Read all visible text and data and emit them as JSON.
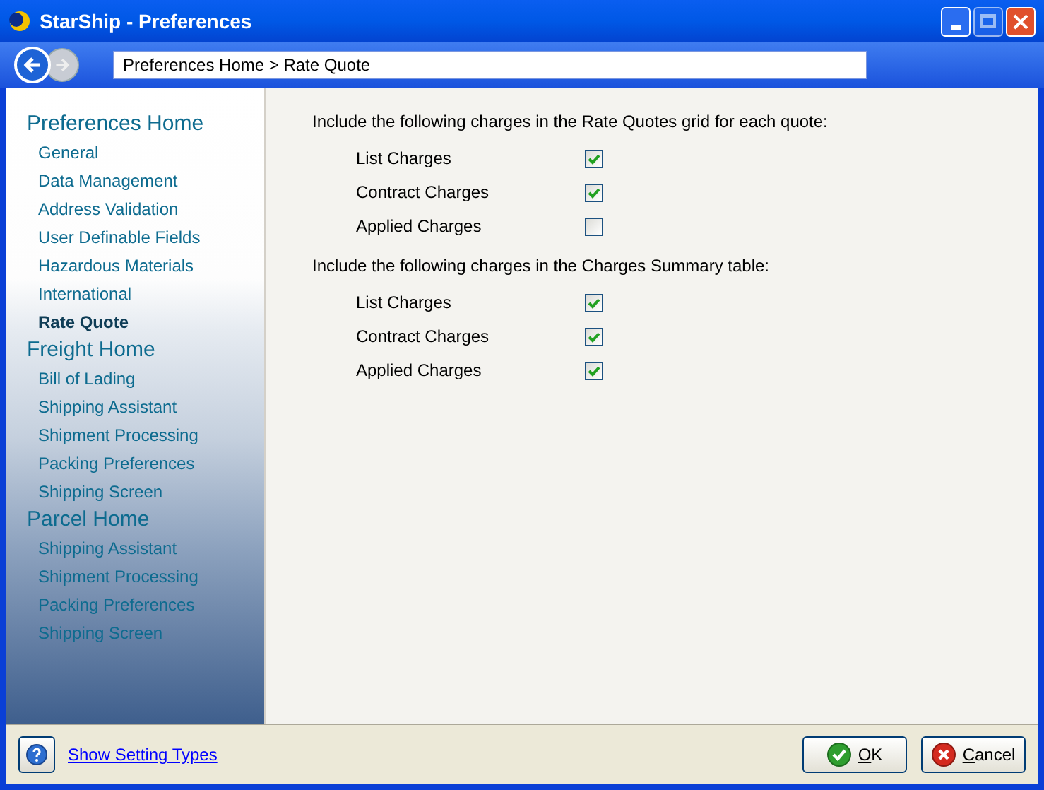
{
  "window": {
    "title": "StarShip - Preferences"
  },
  "breadcrumb": "Preferences Home > Rate Quote",
  "sidebar": [
    {
      "label": "Preferences Home",
      "children": [
        {
          "label": "General",
          "selected": false
        },
        {
          "label": "Data Management",
          "selected": false
        },
        {
          "label": "Address Validation",
          "selected": false
        },
        {
          "label": "User Definable Fields",
          "selected": false
        },
        {
          "label": "Hazardous Materials",
          "selected": false
        },
        {
          "label": "International",
          "selected": false
        },
        {
          "label": "Rate Quote",
          "selected": true
        }
      ]
    },
    {
      "label": "Freight Home",
      "children": [
        {
          "label": "Bill of Lading",
          "selected": false
        },
        {
          "label": "Shipping Assistant",
          "selected": false
        },
        {
          "label": "Shipment Processing",
          "selected": false
        },
        {
          "label": "Packing Preferences",
          "selected": false
        },
        {
          "label": "Shipping Screen",
          "selected": false
        }
      ]
    },
    {
      "label": "Parcel Home",
      "children": [
        {
          "label": "Shipping Assistant",
          "selected": false
        },
        {
          "label": "Shipment Processing",
          "selected": false
        },
        {
          "label": "Packing Preferences",
          "selected": false
        },
        {
          "label": "Shipping Screen",
          "selected": false
        }
      ]
    }
  ],
  "sections": [
    {
      "heading": "Include the following charges in the Rate Quotes grid for each quote:",
      "options": [
        {
          "label": "List Charges",
          "checked": true
        },
        {
          "label": "Contract Charges",
          "checked": true
        },
        {
          "label": "Applied Charges",
          "checked": false
        }
      ]
    },
    {
      "heading": "Include the following charges in the Charges Summary table:",
      "options": [
        {
          "label": "List Charges",
          "checked": true
        },
        {
          "label": "Contract Charges",
          "checked": true
        },
        {
          "label": "Applied Charges",
          "checked": true
        }
      ]
    }
  ],
  "footer": {
    "link": "Show Setting Types",
    "buttons": [
      {
        "kind": "ok",
        "label": "OK"
      },
      {
        "kind": "cancel",
        "label": "Cancel"
      }
    ]
  }
}
